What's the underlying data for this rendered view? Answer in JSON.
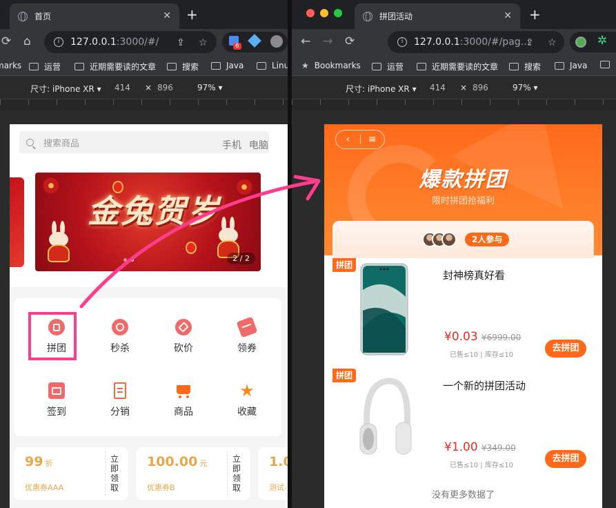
{
  "left_window": {
    "tab_title": "首页",
    "tab_close": "✕",
    "new_tab": "+",
    "url_host": "127.0.0.1",
    "url_rest": ":3000/#/",
    "ext_badge": "6",
    "bookmarks": [
      "marks",
      "运营",
      "近期需要读的文章",
      "搜索",
      "Java",
      "Linux"
    ],
    "device": {
      "label": "尺寸: iPhone XR",
      "width": "414",
      "x": "×",
      "height": "896",
      "zoom": "97%"
    },
    "page": {
      "search_placeholder": "搜索商品",
      "hot_words": [
        "手机",
        "电脑"
      ],
      "banner_title": "金兔贺岁",
      "banner_counter": "2 / 2",
      "grid": [
        "拼团",
        "秒杀",
        "砍价",
        "领券",
        "签到",
        "分销",
        "商品",
        "收藏"
      ],
      "coupons": [
        {
          "amount": "99",
          "unit": "折",
          "name": "优惠券AAA",
          "claim": "立即领取"
        },
        {
          "amount": "100.00",
          "unit": "元",
          "name": "优惠券B",
          "claim": "立即领取"
        },
        {
          "amount": "1.0",
          "unit": "",
          "name": "测试-",
          "claim": ""
        }
      ]
    }
  },
  "right_window": {
    "tab_title": "拼团活动",
    "tab_close": "✕",
    "new_tab": "+",
    "url_host": "127.0.0.1",
    "url_rest": ":3000/#/pag...",
    "bookmarks_label": "Bookmarks",
    "bookmarks": [
      "运营",
      "近期需要读的文章",
      "搜索",
      "Java"
    ],
    "device": {
      "label": "尺寸: iPhone XR",
      "width": "414",
      "x": "×",
      "height": "896",
      "zoom": "97%"
    },
    "page": {
      "title": "爆款拼团",
      "subtitle": "限时拼团抢福利",
      "joined": "2人参与",
      "products": [
        {
          "tag": "拼团",
          "name": "封神榜真好看",
          "price": "¥0.03",
          "original": "¥6999.00",
          "stats": "已售≤10 | 库存≤10",
          "button": "去拼团",
          "image": "phone"
        },
        {
          "tag": "拼团",
          "name": "一个新的拼团活动",
          "price": "¥1.00",
          "original": "¥349.00",
          "stats": "已售≤10 | 库存≤10",
          "button": "去拼团",
          "image": "headphones"
        }
      ],
      "no_more": "没有更多数据了"
    }
  },
  "colors": {
    "accent": "#ff6a1a",
    "price": "#ee2a24",
    "highlight": "#ff3d8e",
    "coupon": "#e5a84b"
  }
}
